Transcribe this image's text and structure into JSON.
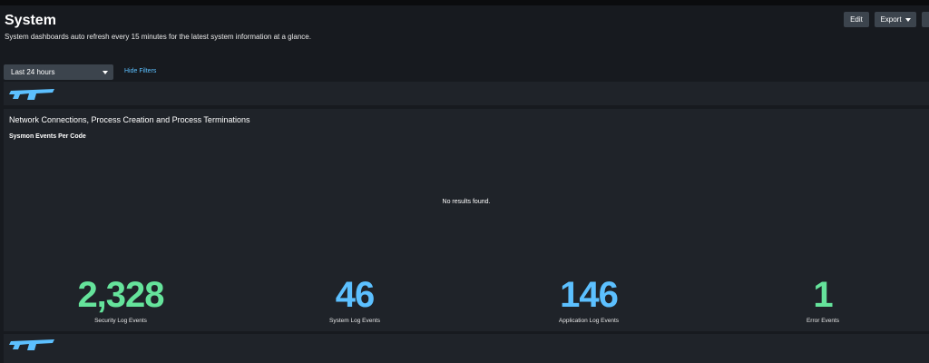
{
  "page": {
    "title": "System",
    "subtitle": "System dashboards auto refresh every 15 minutes for the latest system information at a glance."
  },
  "toolbar": {
    "edit_label": "Edit",
    "export_label": "Export"
  },
  "filters": {
    "time_range": "Last 24 hours",
    "hide_filters_label": "Hide Filters"
  },
  "panel": {
    "title": "Network Connections, Process Creation and Process Terminations",
    "chart_title": "Sysmon Events Per Code",
    "empty_message": "No results found."
  },
  "stats": [
    {
      "value": "2,328",
      "label": "Security Log Events",
      "color": "#65e39b"
    },
    {
      "value": "46",
      "label": "System Log Events",
      "color": "#5cc0ff"
    },
    {
      "value": "146",
      "label": "Application Log Events",
      "color": "#5cc0ff"
    },
    {
      "value": "1",
      "label": "Error Events",
      "color": "#65e39b"
    }
  ],
  "colors": {
    "accent_blue": "#5cc0ff",
    "accent_green": "#65e39b",
    "panel_bg": "#1f2329",
    "page_bg": "#171a1f"
  },
  "icons": {
    "logo": "brand-logo-icon",
    "dropdown": "caret-down-icon"
  }
}
